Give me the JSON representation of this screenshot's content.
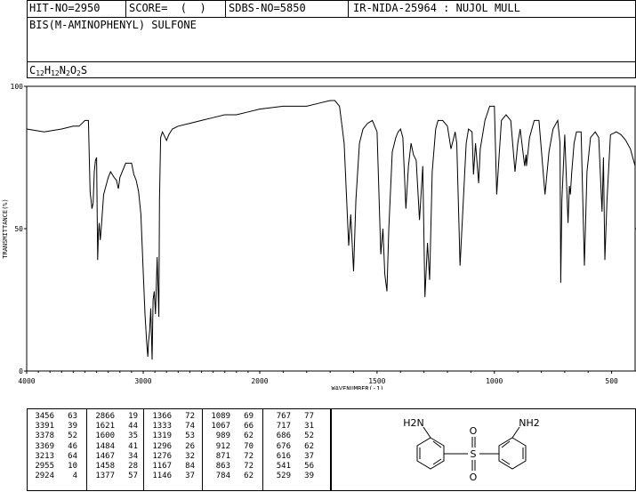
{
  "header": {
    "hit_no": "HIT-NO=2950",
    "score": "SCORE=  (  )",
    "sdbs_no": "SDBS-NO=5850",
    "ir_info": "IR-NIDA-25964 : NUJOL MULL"
  },
  "compound": {
    "name": "BIS(M-AMINOPHENYL) SULFONE",
    "formula_parts": [
      {
        "t": "C",
        "sub": false
      },
      {
        "t": "12",
        "sub": true
      },
      {
        "t": "H",
        "sub": false
      },
      {
        "t": "12",
        "sub": true
      },
      {
        "t": "N",
        "sub": false
      },
      {
        "t": "2",
        "sub": true
      },
      {
        "t": "O",
        "sub": false
      },
      {
        "t": "2",
        "sub": true
      },
      {
        "t": "S",
        "sub": false
      }
    ]
  },
  "chart_data": {
    "type": "line",
    "xlabel": "WAVENUMBER(-1)",
    "ylabel": "TRANSMITTANCE(%)",
    "xlim": [
      4000,
      400
    ],
    "ylim": [
      0,
      100
    ],
    "xticks": [
      4000,
      3000,
      2000,
      1500,
      1000,
      500
    ],
    "yticks": [
      0,
      50,
      100
    ],
    "series": [
      {
        "points": [
          [
            4000,
            85
          ],
          [
            3850,
            84
          ],
          [
            3700,
            85
          ],
          [
            3600,
            86
          ],
          [
            3550,
            86
          ],
          [
            3500,
            88
          ],
          [
            3470,
            88
          ],
          [
            3456,
            63
          ],
          [
            3440,
            57
          ],
          [
            3430,
            59
          ],
          [
            3420,
            70
          ],
          [
            3410,
            74
          ],
          [
            3400,
            75
          ],
          [
            3391,
            39
          ],
          [
            3385,
            48
          ],
          [
            3378,
            52
          ],
          [
            3369,
            46
          ],
          [
            3360,
            50
          ],
          [
            3340,
            62
          ],
          [
            3300,
            68
          ],
          [
            3280,
            70
          ],
          [
            3250,
            68
          ],
          [
            3230,
            67
          ],
          [
            3213,
            64
          ],
          [
            3200,
            68
          ],
          [
            3150,
            73
          ],
          [
            3100,
            73
          ],
          [
            3080,
            69
          ],
          [
            3060,
            67
          ],
          [
            3040,
            63
          ],
          [
            3020,
            55
          ],
          [
            3000,
            35
          ],
          [
            2985,
            20
          ],
          [
            2970,
            10
          ],
          [
            2960,
            5
          ],
          [
            2955,
            10
          ],
          [
            2945,
            14
          ],
          [
            2935,
            22
          ],
          [
            2924,
            4
          ],
          [
            2915,
            25
          ],
          [
            2905,
            28
          ],
          [
            2895,
            20
          ],
          [
            2880,
            40
          ],
          [
            2866,
            19
          ],
          [
            2860,
            60
          ],
          [
            2850,
            82
          ],
          [
            2835,
            84
          ],
          [
            2800,
            81
          ],
          [
            2780,
            83
          ],
          [
            2750,
            85
          ],
          [
            2700,
            86
          ],
          [
            2600,
            87
          ],
          [
            2500,
            88
          ],
          [
            2400,
            89
          ],
          [
            2300,
            90
          ],
          [
            2200,
            90
          ],
          [
            2100,
            91
          ],
          [
            2000,
            92
          ],
          [
            1900,
            93
          ],
          [
            1800,
            93
          ],
          [
            1750,
            94
          ],
          [
            1700,
            95
          ],
          [
            1680,
            95
          ],
          [
            1660,
            93
          ],
          [
            1640,
            80
          ],
          [
            1621,
            44
          ],
          [
            1612,
            55
          ],
          [
            1600,
            35
          ],
          [
            1590,
            60
          ],
          [
            1575,
            80
          ],
          [
            1560,
            85
          ],
          [
            1540,
            87
          ],
          [
            1520,
            88
          ],
          [
            1500,
            84
          ],
          [
            1484,
            41
          ],
          [
            1475,
            50
          ],
          [
            1467,
            34
          ],
          [
            1458,
            28
          ],
          [
            1450,
            50
          ],
          [
            1435,
            77
          ],
          [
            1420,
            82
          ],
          [
            1410,
            84
          ],
          [
            1400,
            85
          ],
          [
            1390,
            82
          ],
          [
            1377,
            57
          ],
          [
            1366,
            72
          ],
          [
            1355,
            80
          ],
          [
            1345,
            76
          ],
          [
            1333,
            74
          ],
          [
            1319,
            53
          ],
          [
            1305,
            72
          ],
          [
            1296,
            26
          ],
          [
            1285,
            45
          ],
          [
            1276,
            32
          ],
          [
            1265,
            70
          ],
          [
            1250,
            85
          ],
          [
            1240,
            88
          ],
          [
            1220,
            88
          ],
          [
            1200,
            86
          ],
          [
            1185,
            78
          ],
          [
            1167,
            84
          ],
          [
            1160,
            80
          ],
          [
            1146,
            37
          ],
          [
            1135,
            55
          ],
          [
            1120,
            80
          ],
          [
            1110,
            85
          ],
          [
            1095,
            84
          ],
          [
            1089,
            69
          ],
          [
            1080,
            80
          ],
          [
            1067,
            66
          ],
          [
            1060,
            78
          ],
          [
            1040,
            88
          ],
          [
            1020,
            93
          ],
          [
            1000,
            93
          ],
          [
            990,
            62
          ],
          [
            980,
            75
          ],
          [
            970,
            88
          ],
          [
            950,
            90
          ],
          [
            930,
            88
          ],
          [
            912,
            70
          ],
          [
            900,
            80
          ],
          [
            890,
            85
          ],
          [
            871,
            72
          ],
          [
            865,
            76
          ],
          [
            863,
            72
          ],
          [
            850,
            82
          ],
          [
            830,
            88
          ],
          [
            810,
            88
          ],
          [
            784,
            62
          ],
          [
            775,
            70
          ],
          [
            767,
            77
          ],
          [
            750,
            85
          ],
          [
            730,
            88
          ],
          [
            720,
            80
          ],
          [
            717,
            31
          ],
          [
            712,
            60
          ],
          [
            700,
            83
          ],
          [
            686,
            52
          ],
          [
            680,
            65
          ],
          [
            676,
            62
          ],
          [
            670,
            70
          ],
          [
            660,
            80
          ],
          [
            650,
            84
          ],
          [
            630,
            84
          ],
          [
            616,
            37
          ],
          [
            605,
            70
          ],
          [
            590,
            82
          ],
          [
            570,
            84
          ],
          [
            555,
            82
          ],
          [
            541,
            56
          ],
          [
            535,
            75
          ],
          [
            529,
            39
          ],
          [
            520,
            60
          ],
          [
            505,
            83
          ],
          [
            480,
            84
          ],
          [
            460,
            83
          ],
          [
            440,
            81
          ],
          [
            420,
            78
          ],
          [
            400,
            72
          ]
        ]
      }
    ]
  },
  "peak_table": {
    "columns": [
      [
        [
          "3456",
          "63"
        ],
        [
          "3391",
          "39"
        ],
        [
          "3378",
          "52"
        ],
        [
          "3369",
          "46"
        ],
        [
          "3213",
          "64"
        ],
        [
          "2955",
          "10"
        ],
        [
          "2924",
          "4"
        ]
      ],
      [
        [
          "2866",
          "19"
        ],
        [
          "1621",
          "44"
        ],
        [
          "1600",
          "35"
        ],
        [
          "1484",
          "41"
        ],
        [
          "1467",
          "34"
        ],
        [
          "1458",
          "28"
        ],
        [
          "1377",
          "57"
        ]
      ],
      [
        [
          "1366",
          "72"
        ],
        [
          "1333",
          "74"
        ],
        [
          "1319",
          "53"
        ],
        [
          "1296",
          "26"
        ],
        [
          "1276",
          "32"
        ],
        [
          "1167",
          "84"
        ],
        [
          "1146",
          "37"
        ]
      ],
      [
        [
          "1089",
          "69"
        ],
        [
          "1067",
          "66"
        ],
        [
          "989",
          "62"
        ],
        [
          "912",
          "70"
        ],
        [
          "871",
          "72"
        ],
        [
          "863",
          "72"
        ],
        [
          "784",
          "62"
        ]
      ],
      [
        [
          "767",
          "77"
        ],
        [
          "717",
          "31"
        ],
        [
          "686",
          "52"
        ],
        [
          "676",
          "62"
        ],
        [
          "616",
          "37"
        ],
        [
          "541",
          "56"
        ],
        [
          "529",
          "39"
        ]
      ]
    ]
  },
  "structure": {
    "amine_left": "H2N",
    "amine_right": "NH2",
    "o_top": "O",
    "o_bottom": "O",
    "s": "S"
  }
}
